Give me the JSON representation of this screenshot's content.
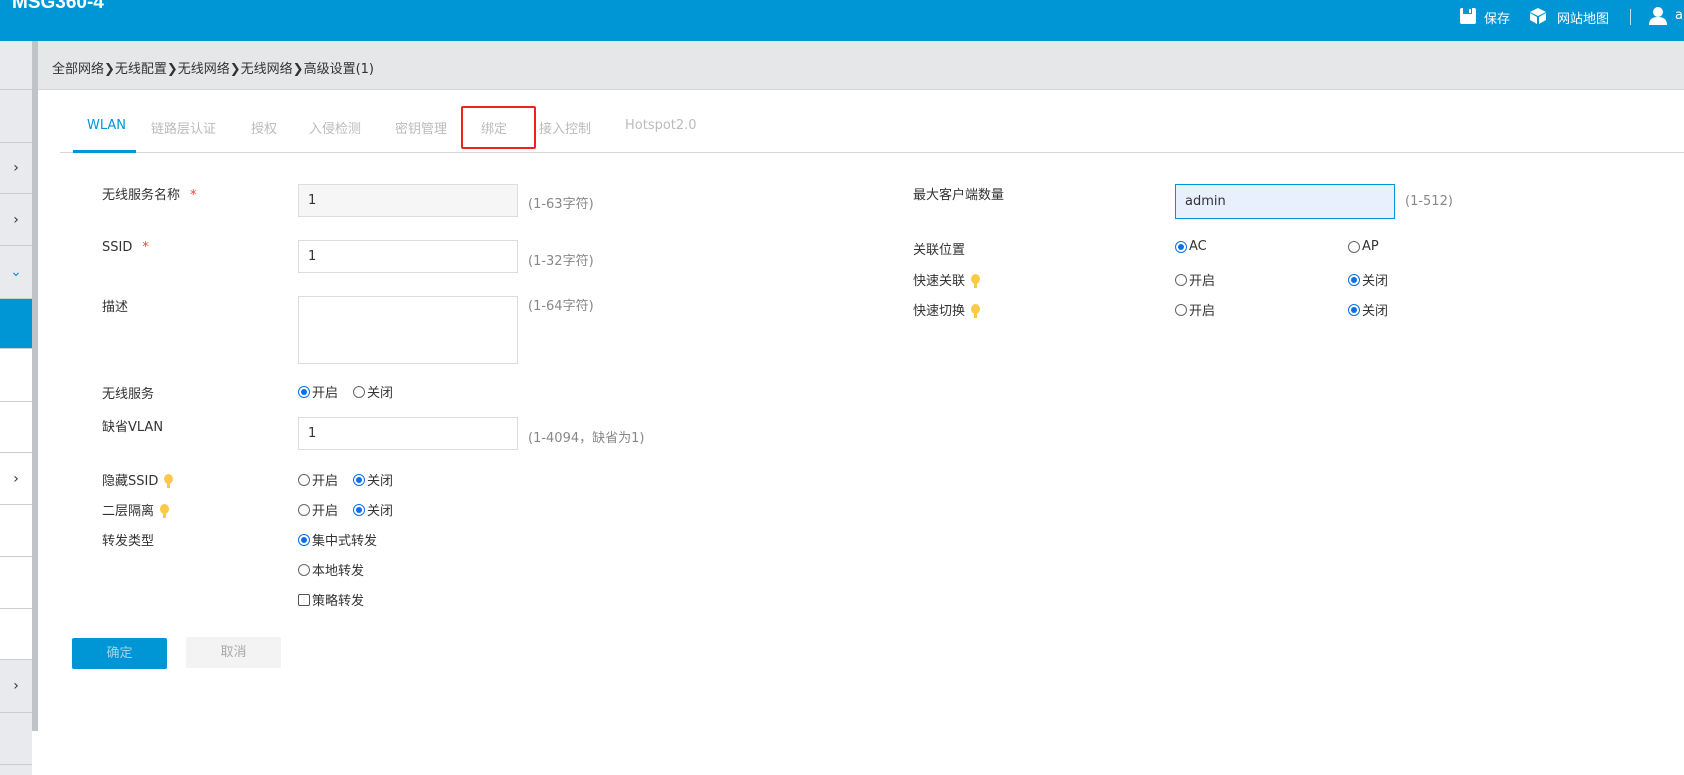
{
  "header": {
    "title": "MSG360-4",
    "save": "保存",
    "sitemap": "网站地图",
    "user": "a"
  },
  "breadcrumb": "全部网络❯无线配置❯无线网络❯无线网络❯高级设置(1)",
  "tabs": [
    {
      "label": "WLAN",
      "active": true
    },
    {
      "label": "链路层认证"
    },
    {
      "label": "授权"
    },
    {
      "label": "入侵检测"
    },
    {
      "label": "密钥管理"
    },
    {
      "label": "绑定",
      "highlighted": true
    },
    {
      "label": "接入控制"
    },
    {
      "label": "Hotspot2.0"
    }
  ],
  "form": {
    "service_name": {
      "label": "无线服务名称",
      "required": "*",
      "value": "1",
      "hint": "(1-63字符)"
    },
    "ssid": {
      "label": "SSID",
      "required": "*",
      "value": "1",
      "hint": "(1-32字符)"
    },
    "description": {
      "label": "描述",
      "value": "",
      "hint": "(1-64字符)"
    },
    "wireless_service": {
      "label": "无线服务",
      "on": "开启",
      "off": "关闭",
      "selected": "开启"
    },
    "default_vlan": {
      "label": "缺省VLAN",
      "value": "1",
      "hint": "(1-4094，缺省为1)"
    },
    "hide_ssid": {
      "label": "隐藏SSID",
      "on": "开启",
      "off": "关闭",
      "selected": "关闭"
    },
    "l2_isolation": {
      "label": "二层隔离",
      "on": "开启",
      "off": "关闭",
      "selected": "关闭"
    },
    "forward_type": {
      "label": "转发类型",
      "central": "集中式转发",
      "local": "本地转发",
      "policy": "策略转发",
      "selected": "集中式转发",
      "policy_checked": false
    },
    "max_clients": {
      "label": "最大客户端数量",
      "value": "admin",
      "hint": "(1-512)"
    },
    "assoc_location": {
      "label": "关联位置",
      "ac": "AC",
      "ap": "AP",
      "selected": "AC"
    },
    "fast_assoc": {
      "label": "快速关联",
      "on": "开启",
      "off": "关闭",
      "selected": "关闭"
    },
    "fast_roam": {
      "label": "快速切换",
      "on": "开启",
      "off": "关闭",
      "selected": "关闭"
    }
  },
  "buttons": {
    "ok": "确定",
    "cancel": "取消"
  },
  "colors": {
    "brand": "#0096d6",
    "highlight_box": "#f2211c",
    "bulb": "#fcc84a"
  }
}
